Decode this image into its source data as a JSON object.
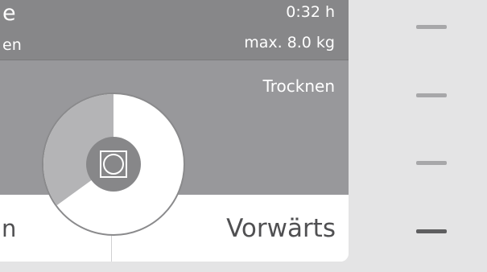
{
  "header": {
    "title_fragment": "e",
    "subtitle_fragment": "en",
    "time": "0:32 h",
    "max_load": "max. 8.0 kg"
  },
  "mode": {
    "label": "Trocknen"
  },
  "dial": {
    "icon": "drying-icon",
    "progress": 0.65,
    "colors": {
      "filled": "#ffffff",
      "remaining": "#b4b4b6",
      "center": "#878789"
    }
  },
  "buttons": {
    "left_fragment": "n",
    "forward": "Vorwärts"
  },
  "side_indicators": {
    "count": 4,
    "active_index": 3
  },
  "colors": {
    "background": "#e4e4e5",
    "header": "#878789",
    "section": "#98989b",
    "indicator": "#a7a7a9",
    "indicator_active": "#5e5e60"
  }
}
